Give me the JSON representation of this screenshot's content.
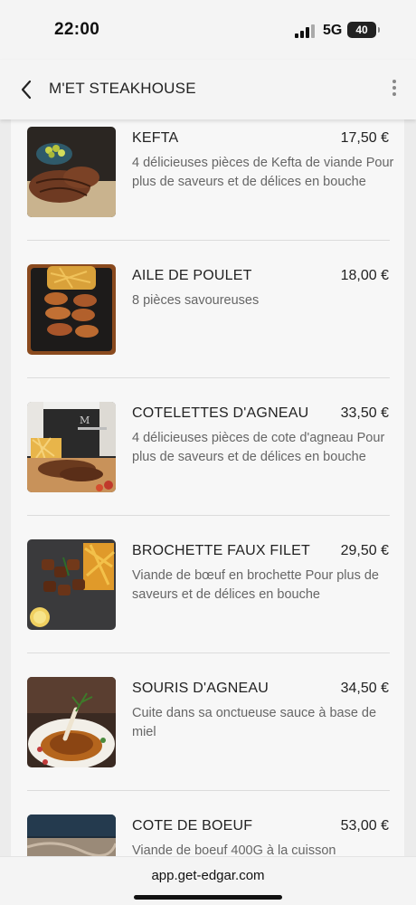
{
  "status": {
    "time": "22:00",
    "network": "5G",
    "battery": "40"
  },
  "header": {
    "title": "M'ET STEAKHOUSE"
  },
  "menu": [
    {
      "name": "KEFTA",
      "price": "17,50 €",
      "description": "4 délicieuses pièces de Kefta de viande Pour plus de saveurs et de délices en bouche"
    },
    {
      "name": "AILE DE POULET",
      "price": "18,00 €",
      "description": "8 pièces savoureuses"
    },
    {
      "name": "COTELETTES D'AGNEAU",
      "price": "33,50 €",
      "description": "4 délicieuses pièces de cote d'agneau Pour plus de saveurs et de délices en bouche"
    },
    {
      "name": "BROCHETTE FAUX FILET",
      "price": "29,50 €",
      "description": "Viande de bœuf en brochette Pour plus de saveurs et de délices en bouche"
    },
    {
      "name": "SOURIS D'AGNEAU",
      "price": "34,50 €",
      "description": "Cuite dans sa onctueuse sauce à base de miel"
    },
    {
      "name": "COTE DE BOEUF",
      "price": "53,00 €",
      "description": "Viande de boeuf 400G à la cuisson"
    }
  ],
  "browser": {
    "url": "app.get-edgar.com"
  }
}
